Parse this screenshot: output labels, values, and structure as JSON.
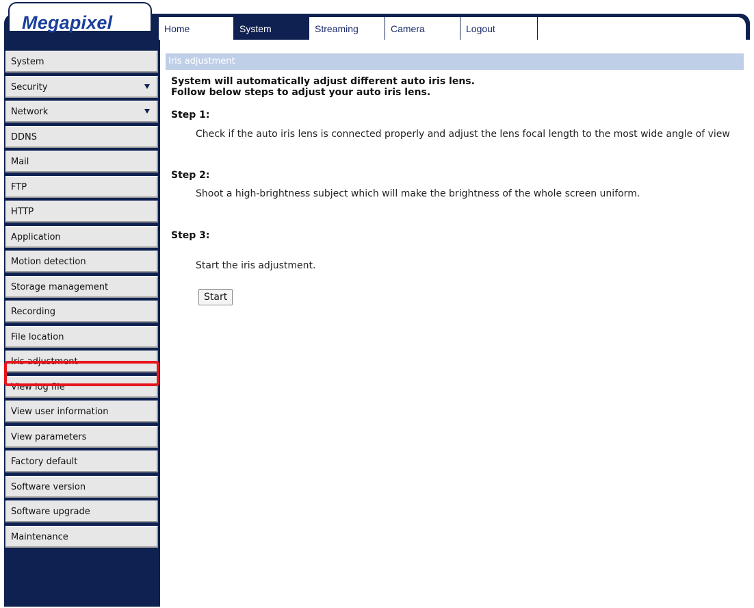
{
  "brand": {
    "logo": "Megapixel"
  },
  "topnav": {
    "tabs": [
      "Home",
      "System",
      "Streaming",
      "Camera",
      "Logout"
    ],
    "active": "System"
  },
  "sidebar": {
    "items": [
      {
        "label": "System"
      },
      {
        "label": "Security",
        "expandable": true
      },
      {
        "label": "Network",
        "expandable": true
      },
      {
        "label": "DDNS"
      },
      {
        "label": "Mail"
      },
      {
        "label": "FTP"
      },
      {
        "label": "HTTP"
      },
      {
        "label": "Application"
      },
      {
        "label": "Motion detection"
      },
      {
        "label": "Storage management"
      },
      {
        "label": "Recording"
      },
      {
        "label": "File location"
      },
      {
        "label": "Iris adjustment"
      },
      {
        "label": "View log file"
      },
      {
        "label": "View user information"
      },
      {
        "label": "View parameters"
      },
      {
        "label": "Factory default"
      },
      {
        "label": "Software version"
      },
      {
        "label": "Software upgrade"
      },
      {
        "label": "Maintenance"
      }
    ],
    "highlighted": "Iris adjustment"
  },
  "main": {
    "header": "Iris adjustment",
    "intro_line1": "System will automatically adjust different auto iris lens.",
    "intro_line2": "Follow below steps to adjust your auto iris lens.",
    "steps": [
      {
        "title": "Step 1:",
        "text": "Check if the auto iris lens is connected properly and adjust the lens focal length to the most wide angle of view"
      },
      {
        "title": "Step 2:",
        "text": "Shoot a high-brightness subject which will make the brightness of the whole screen uniform."
      },
      {
        "title": "Step 3:",
        "text": "Start the iris adjustment."
      }
    ],
    "start_button": "Start"
  },
  "colors": {
    "frame": "#0f2150",
    "header_bg": "#c0cfe8",
    "highlight": "#e8141d",
    "logo": "#1a3f9c"
  }
}
